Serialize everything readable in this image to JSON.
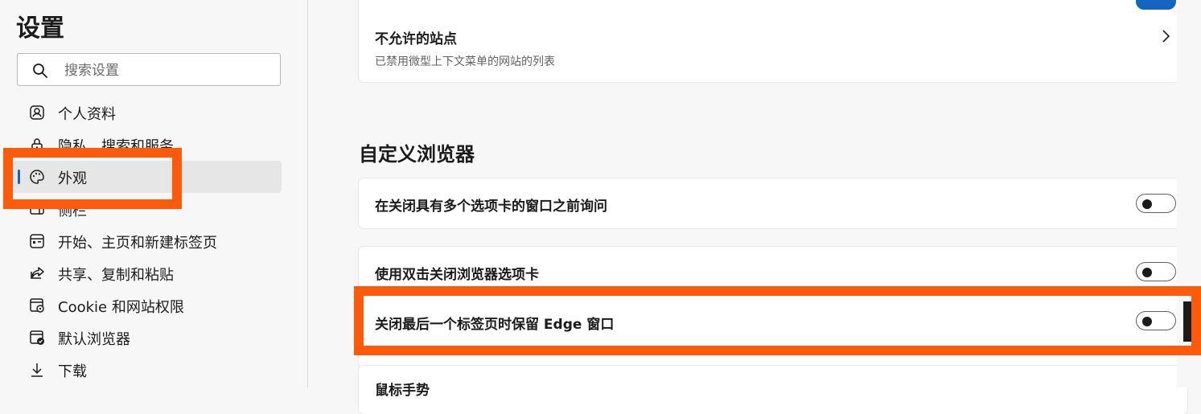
{
  "sidebar": {
    "title": "设置",
    "search": {
      "placeholder": "搜索设置",
      "value": ""
    },
    "items": [
      {
        "label": "个人资料",
        "icon": "profile-icon",
        "active": false
      },
      {
        "label": "隐私、搜索和服务",
        "icon": "lock-icon",
        "active": false
      },
      {
        "label": "外观",
        "icon": "palette-icon",
        "active": true
      },
      {
        "label": "侧栏",
        "icon": "sidebar-icon",
        "active": false
      },
      {
        "label": "开始、主页和新建标签页",
        "icon": "home-page-icon",
        "active": false
      },
      {
        "label": "共享、复制和粘贴",
        "icon": "share-icon",
        "active": false
      },
      {
        "label": "Cookie 和网站权限",
        "icon": "cookie-permissions-icon",
        "active": false
      },
      {
        "label": "默认浏览器",
        "icon": "default-browser-icon",
        "active": false
      },
      {
        "label": "下载",
        "icon": "download-icon",
        "active": false
      }
    ]
  },
  "main": {
    "blocked_sites": {
      "title": "不允许的站点",
      "description": "已禁用微型上下文菜单的网站的列表"
    },
    "customize_section": {
      "title": "自定义浏览器",
      "settings": [
        {
          "label": "在关闭具有多个选项卡的窗口之前询问",
          "enabled": false
        },
        {
          "label": "使用双击关闭浏览器选项卡",
          "enabled": false
        },
        {
          "label": "关闭最后一个标签页时保留 Edge 窗口",
          "enabled": false
        },
        {
          "label": "鼠标手势"
        }
      ]
    }
  },
  "colors": {
    "accent": "#1565c0",
    "highlight": "#ff5a0a",
    "background": "#f7f7f7",
    "card": "#ffffff"
  }
}
